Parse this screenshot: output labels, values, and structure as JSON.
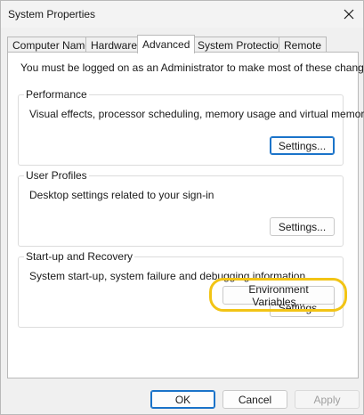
{
  "window": {
    "title": "System Properties",
    "close_icon": "close-icon"
  },
  "tabs": [
    {
      "label": "Computer Name",
      "active": false
    },
    {
      "label": "Hardware",
      "active": false
    },
    {
      "label": "Advanced",
      "active": true
    },
    {
      "label": "System Protection",
      "active": false
    },
    {
      "label": "Remote",
      "active": false
    }
  ],
  "admin_note": "You must be logged on as an Administrator to make most of these changes.",
  "performance": {
    "title": "Performance",
    "description": "Visual effects, processor scheduling, memory usage and virtual memory",
    "button": "Settings..."
  },
  "user_profiles": {
    "title": "User Profiles",
    "description": "Desktop settings related to your sign-in",
    "button": "Settings..."
  },
  "startup_recovery": {
    "title": "Start-up and Recovery",
    "description": "System start-up, system failure and debugging information",
    "button": "Settings..."
  },
  "environment_variables_button": "Environment Variables...",
  "footer": {
    "ok": "OK",
    "cancel": "Cancel",
    "apply": "Apply"
  },
  "colors": {
    "highlight_ring": "#f2c415",
    "default_button_border": "#1a73c9"
  }
}
